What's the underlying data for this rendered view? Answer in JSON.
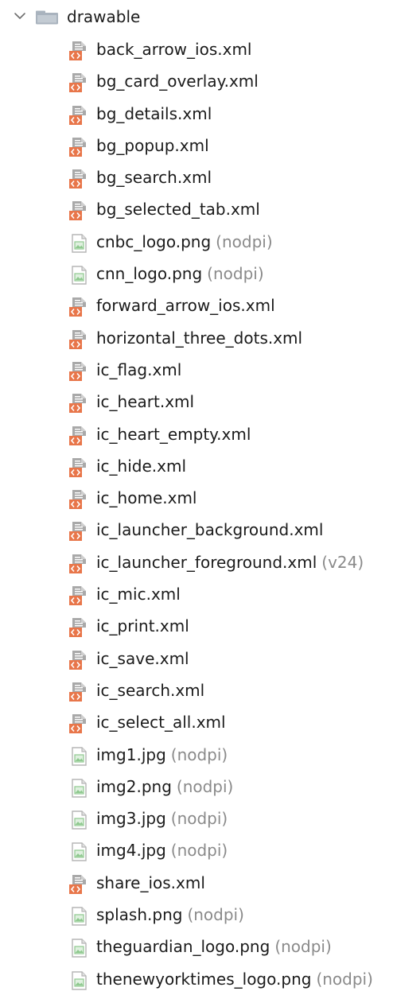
{
  "tree": {
    "folder": {
      "name": "drawable",
      "expanded": true,
      "icon": "folder-icon"
    },
    "items": [
      {
        "name": "back_arrow_ios.xml",
        "qualifier": "",
        "icon": "xml-file-icon"
      },
      {
        "name": "bg_card_overlay.xml",
        "qualifier": "",
        "icon": "xml-file-icon"
      },
      {
        "name": "bg_details.xml",
        "qualifier": "",
        "icon": "xml-file-icon"
      },
      {
        "name": "bg_popup.xml",
        "qualifier": "",
        "icon": "xml-file-icon"
      },
      {
        "name": "bg_search.xml",
        "qualifier": "",
        "icon": "xml-file-icon"
      },
      {
        "name": "bg_selected_tab.xml",
        "qualifier": "",
        "icon": "xml-file-icon"
      },
      {
        "name": "cnbc_logo.png",
        "qualifier": "(nodpi)",
        "icon": "image-file-icon"
      },
      {
        "name": "cnn_logo.png",
        "qualifier": "(nodpi)",
        "icon": "image-file-icon"
      },
      {
        "name": "forward_arrow_ios.xml",
        "qualifier": "",
        "icon": "xml-file-icon"
      },
      {
        "name": "horizontal_three_dots.xml",
        "qualifier": "",
        "icon": "xml-file-icon"
      },
      {
        "name": "ic_flag.xml",
        "qualifier": "",
        "icon": "xml-file-icon"
      },
      {
        "name": "ic_heart.xml",
        "qualifier": "",
        "icon": "xml-file-icon"
      },
      {
        "name": "ic_heart_empty.xml",
        "qualifier": "",
        "icon": "xml-file-icon"
      },
      {
        "name": "ic_hide.xml",
        "qualifier": "",
        "icon": "xml-file-icon"
      },
      {
        "name": "ic_home.xml",
        "qualifier": "",
        "icon": "xml-file-icon"
      },
      {
        "name": "ic_launcher_background.xml",
        "qualifier": "",
        "icon": "xml-file-icon"
      },
      {
        "name": "ic_launcher_foreground.xml",
        "qualifier": "(v24)",
        "icon": "xml-file-icon"
      },
      {
        "name": "ic_mic.xml",
        "qualifier": "",
        "icon": "xml-file-icon"
      },
      {
        "name": "ic_print.xml",
        "qualifier": "",
        "icon": "xml-file-icon"
      },
      {
        "name": "ic_save.xml",
        "qualifier": "",
        "icon": "xml-file-icon"
      },
      {
        "name": "ic_search.xml",
        "qualifier": "",
        "icon": "xml-file-icon"
      },
      {
        "name": "ic_select_all.xml",
        "qualifier": "",
        "icon": "xml-file-icon"
      },
      {
        "name": "img1.jpg",
        "qualifier": "(nodpi)",
        "icon": "image-file-icon"
      },
      {
        "name": "img2.png",
        "qualifier": "(nodpi)",
        "icon": "image-file-icon"
      },
      {
        "name": "img3.jpg",
        "qualifier": "(nodpi)",
        "icon": "image-file-icon"
      },
      {
        "name": "img4.jpg",
        "qualifier": "(nodpi)",
        "icon": "image-file-icon"
      },
      {
        "name": "share_ios.xml",
        "qualifier": "",
        "icon": "xml-file-icon"
      },
      {
        "name": "splash.png",
        "qualifier": "(nodpi)",
        "icon": "image-file-icon"
      },
      {
        "name": "theguardian_logo.png",
        "qualifier": "(nodpi)",
        "icon": "image-file-icon"
      },
      {
        "name": "thenewyorktimes_logo.png",
        "qualifier": "(nodpi)",
        "icon": "image-file-icon"
      }
    ]
  },
  "colors": {
    "text": "#1b1b1b",
    "qualifier": "#8a8a8a",
    "xml_badge": "#e8764a",
    "xml_sheet": "#a9a9a9",
    "image_frame": "#b5b5b5",
    "image_green": "#8fc98f",
    "folder": "#a9b3be",
    "chevron": "#6f6f6f"
  }
}
